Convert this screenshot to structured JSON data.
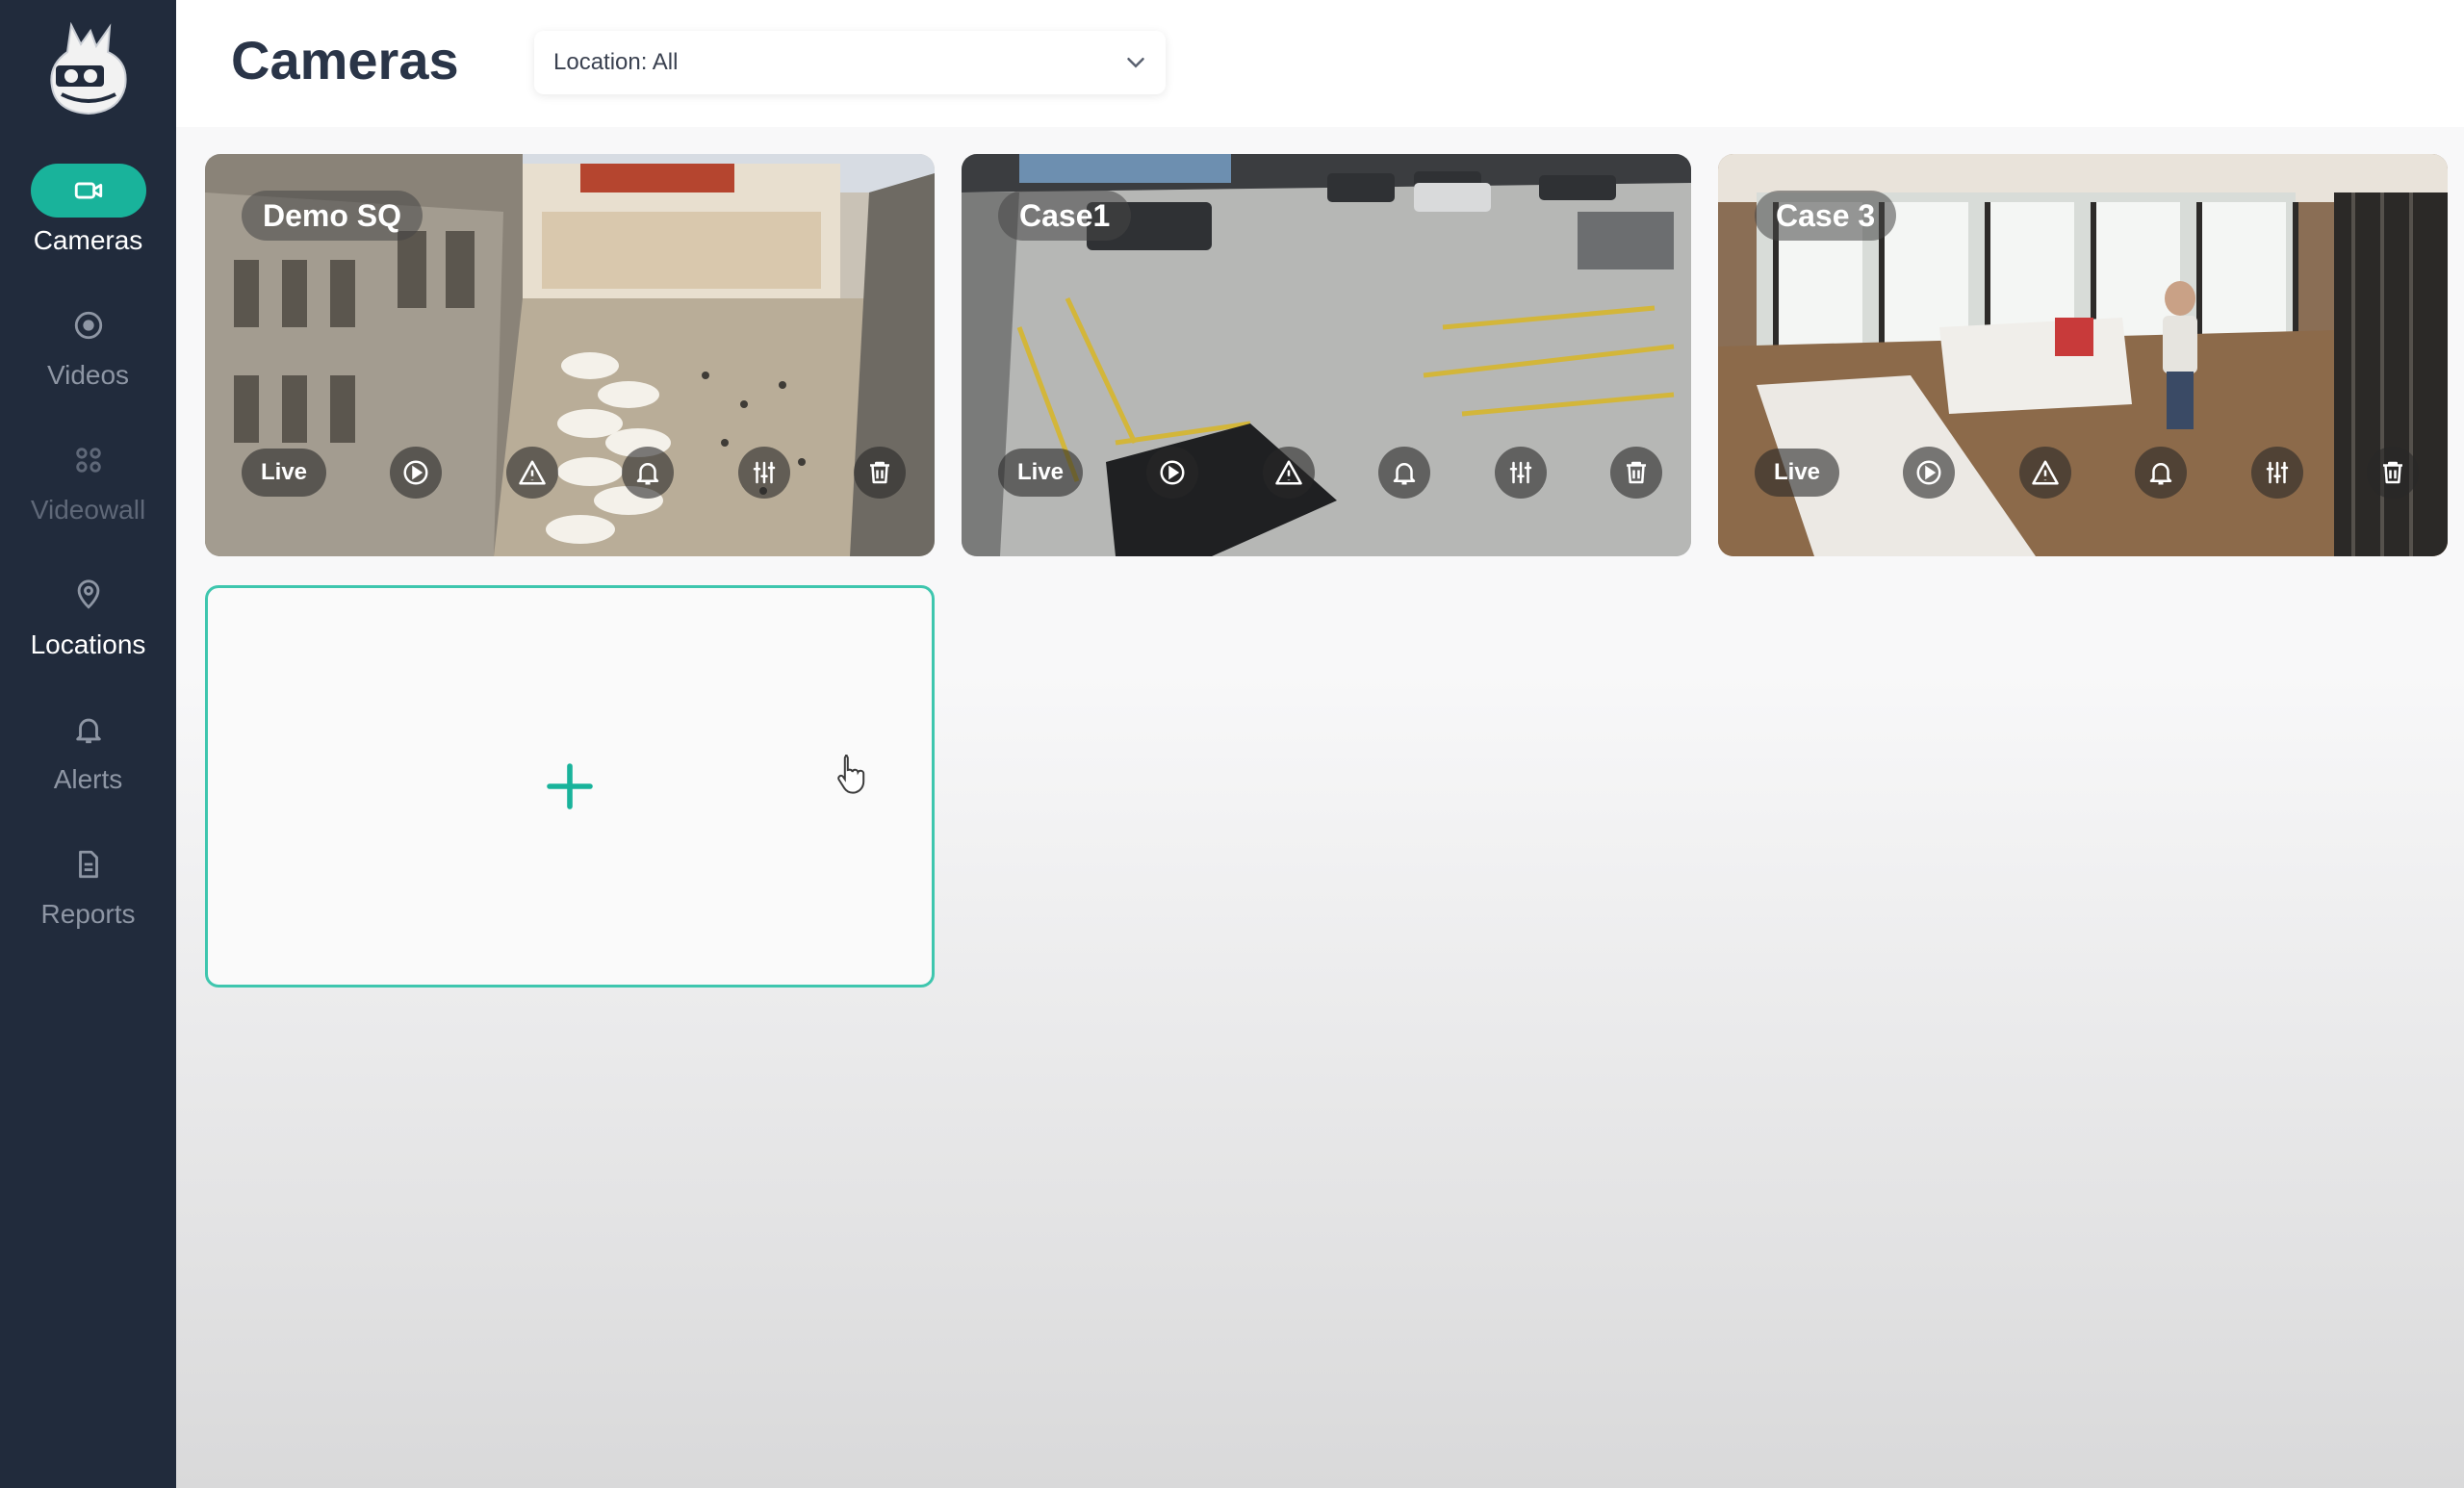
{
  "sidebar": {
    "logo": "owl-camera-logo",
    "items": [
      {
        "label": "Cameras",
        "icon": "camera-icon",
        "active": true
      },
      {
        "label": "Videos",
        "icon": "play-circle-icon",
        "active": false
      },
      {
        "label": "Videowall",
        "icon": "grid-icon",
        "active": false
      },
      {
        "label": "Locations",
        "icon": "map-pin-icon",
        "active": false
      },
      {
        "label": "Alerts",
        "icon": "bell-icon",
        "active": false
      },
      {
        "label": "Reports",
        "icon": "document-icon",
        "active": false
      }
    ]
  },
  "header": {
    "title": "Cameras",
    "location_filter": {
      "value": "Location: All",
      "icon": "chevron-down-icon"
    }
  },
  "cameras": [
    {
      "name": "Demo SQ",
      "live_label": "Live"
    },
    {
      "name": "Case1",
      "live_label": "Live"
    },
    {
      "name": "Case 3",
      "live_label": "Live"
    }
  ],
  "camera_actions": [
    "play-icon",
    "warning-icon",
    "bell-icon",
    "sliders-icon",
    "trash-icon"
  ],
  "add_card": {
    "icon": "plus-icon"
  },
  "colors": {
    "sidebar_bg": "#212b3c",
    "accent": "#19b39b",
    "add_border": "#3ec6ae",
    "title": "#2a3548"
  }
}
